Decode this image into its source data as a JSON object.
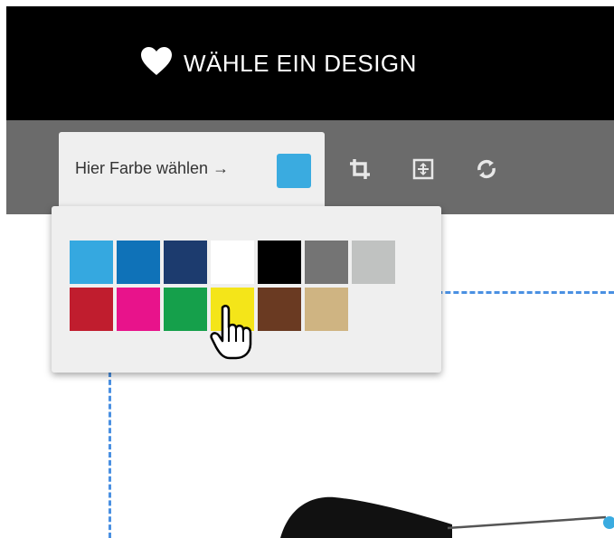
{
  "header": {
    "title": "WÄHLE EIN DESIGN",
    "icon": "heart-icon"
  },
  "toolbar": {
    "color_tab_label": "Hier Farbe wählen →",
    "selected_color": "#3aabe0",
    "tools": [
      {
        "name": "crop-icon"
      },
      {
        "name": "center-icon"
      },
      {
        "name": "rotate-icon"
      }
    ]
  },
  "color_picker": {
    "rows": [
      [
        "#35a8e0",
        "#0f72b8",
        "#1c3b6e",
        "#ffffff",
        "#000000",
        "#747474",
        "#c0c2c1"
      ],
      [
        "#c01d2e",
        "#e8138b",
        "#15a04b",
        "#f4e519",
        "#6a3a22",
        "#cfb482"
      ]
    ],
    "hovered": "#f4e519"
  },
  "colors": {
    "header_bg": "#000000",
    "toolbar_bg": "#6b6b6b",
    "panel_bg": "#efefef",
    "guide": "#4a90e2"
  }
}
